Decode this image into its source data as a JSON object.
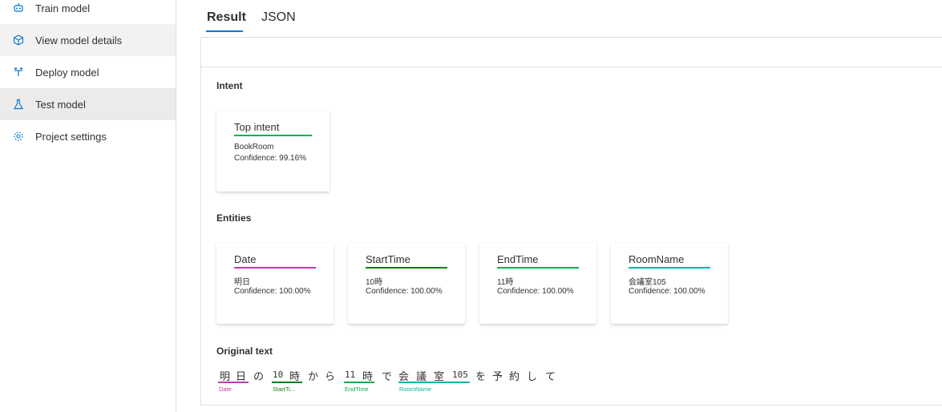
{
  "sidebar": {
    "items": [
      {
        "label": "Train model",
        "icon": "robot-icon"
      },
      {
        "label": "View model details",
        "icon": "cube-icon"
      },
      {
        "label": "Deploy model",
        "icon": "deploy-icon"
      },
      {
        "label": "Test model",
        "icon": "flask-icon"
      },
      {
        "label": "Project settings",
        "icon": "gear-icon"
      }
    ]
  },
  "tabs": [
    {
      "label": "Result",
      "selected": true
    },
    {
      "label": "JSON",
      "selected": false
    }
  ],
  "intent": {
    "section_title": "Intent",
    "card": {
      "title": "Top intent",
      "value": "BookRoom",
      "confidence": "Confidence: 99.16%"
    }
  },
  "entities": {
    "section_title": "Entities",
    "cards": [
      {
        "title": "Date",
        "value": "明日",
        "confidence": "Confidence: 100.00%",
        "color": "#c239b3"
      },
      {
        "title": "StartTime",
        "value": "10時",
        "confidence": "Confidence: 100.00%",
        "color": "#107c10"
      },
      {
        "title": "EndTime",
        "value": "11時",
        "confidence": "Confidence: 100.00%",
        "color": "#00b050"
      },
      {
        "title": "RoomName",
        "value": "会議室105",
        "confidence": "Confidence: 100.00%",
        "color": "#00b7a0"
      }
    ]
  },
  "original_text": {
    "section_title": "Original text",
    "tokens": [
      "明",
      "日",
      "の",
      "10",
      "時",
      "か",
      "ら",
      "11",
      "時",
      "で",
      "会",
      "議",
      "室",
      "105",
      "を",
      "予",
      "約",
      "し",
      "て"
    ],
    "entity_labels": [
      {
        "label": "Date",
        "color": "#c239b3"
      },
      {
        "label": "StartTi...",
        "color": "#107c10"
      },
      {
        "label": "EndTime",
        "color": "#00b050"
      },
      {
        "label": "RoomName",
        "color": "#00b7a0"
      }
    ]
  },
  "colors": {
    "accent": "#0078d4",
    "intent_line": "#00b050"
  }
}
